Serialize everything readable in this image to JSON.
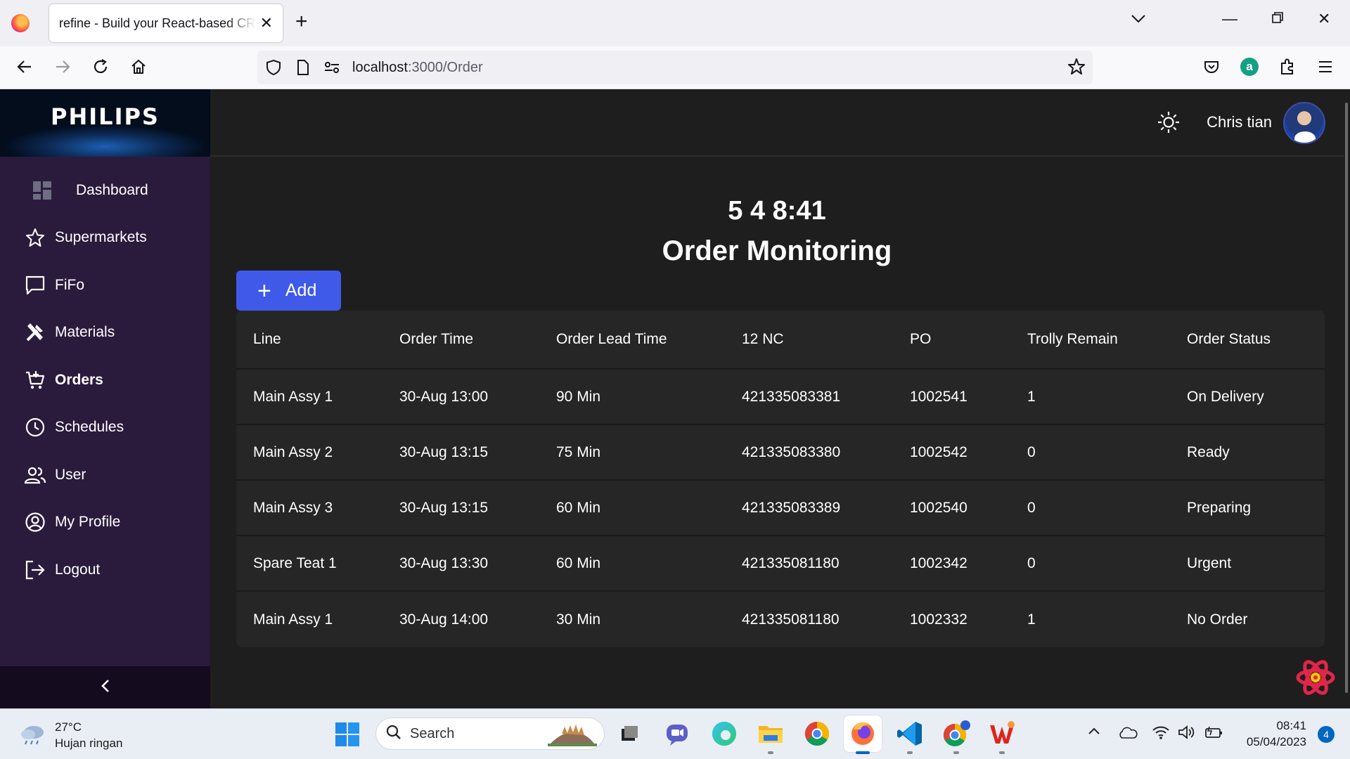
{
  "browser": {
    "tab_title": "refine - Build your React-based CRUD applications, without constraints",
    "url_host": "localhost",
    "url_path": ":3000/Order"
  },
  "sidebar": {
    "brand": "PHILIPS",
    "items": [
      {
        "label": "Dashboard",
        "icon": "dashboard-icon"
      },
      {
        "label": "Supermarkets",
        "icon": "star-icon"
      },
      {
        "label": "FiFo",
        "icon": "chat-bubble-icon"
      },
      {
        "label": "Materials",
        "icon": "tools-icon"
      },
      {
        "label": "Orders",
        "icon": "cart-icon",
        "active": true
      },
      {
        "label": "Schedules",
        "icon": "clock-icon"
      },
      {
        "label": "User",
        "icon": "users-icon"
      },
      {
        "label": "My Profile",
        "icon": "profile-icon"
      },
      {
        "label": "Logout",
        "icon": "logout-icon"
      }
    ]
  },
  "header": {
    "user_name": "Chris tian"
  },
  "main": {
    "clock": "5 4 8:41",
    "title": "Order Monitoring",
    "add_label": "Add",
    "table": {
      "columns": [
        "Line",
        "Order Time",
        "Order Lead Time",
        "12 NC",
        "PO",
        "Trolly Remain",
        "Order Status"
      ],
      "rows": [
        [
          "Main Assy 1",
          "30-Aug 13:00",
          "90 Min",
          "421335083381",
          "1002541",
          "1",
          "On Delivery"
        ],
        [
          "Main Assy 2",
          "30-Aug 13:15",
          "75 Min",
          "421335083380",
          "1002542",
          "0",
          "Ready"
        ],
        [
          "Main Assy 3",
          "30-Aug 13:15",
          "60 Min",
          "421335083389",
          "1002540",
          "0",
          "Preparing"
        ],
        [
          "Spare Teat 1",
          "30-Aug 13:30",
          "60 Min",
          "421335081180",
          "1002342",
          "0",
          "Urgent"
        ],
        [
          "Main Assy 1",
          "30-Aug 14:00",
          "30 Min",
          "421335081180",
          "1002332",
          "1",
          "No Order"
        ]
      ]
    }
  },
  "taskbar": {
    "weather_temp": "27°C",
    "weather_desc": "Hujan ringan",
    "search_label": "Search",
    "time": "08:41",
    "date": "05/04/2023",
    "notifications": "4"
  },
  "colors": {
    "accent": "#3f5ae8",
    "sidebar_bg": "#2a1b3d",
    "content_bg": "#1e1e1e",
    "table_bg": "#262626"
  }
}
